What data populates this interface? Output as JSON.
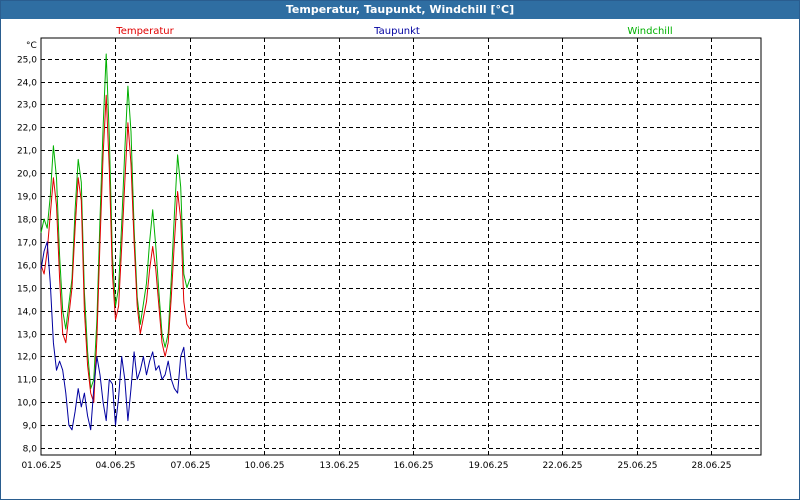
{
  "window": {
    "title": "Temperatur, Taupunkt, Windchill [°C]"
  },
  "colors": {
    "Temperatur": "#e00000",
    "Taupunkt": "#0000a0",
    "Windchill": "#00b000",
    "titlebar": "#2f6ea2"
  },
  "chart_data": {
    "type": "line",
    "title": "Temperatur, Taupunkt, Windchill [°C]",
    "ylabel": "°C",
    "xlabel": "",
    "ylim": [
      7.7,
      25.9
    ],
    "xlim": [
      "01.06.25",
      "30.06.25"
    ],
    "grid": true,
    "legend_position": "top",
    "y_ticks": [
      "8,0",
      "9,0",
      "10,0",
      "11,0",
      "12,0",
      "13,0",
      "14,0",
      "15,0",
      "16,0",
      "17,0",
      "18,0",
      "19,0",
      "20,0",
      "21,0",
      "22,0",
      "23,0",
      "24,0",
      "25,0"
    ],
    "x_ticks": [
      "01.06.25",
      "04.06.25",
      "07.06.25",
      "10.06.25",
      "13.06.25",
      "16.06.25",
      "19.06.25",
      "22.06.25",
      "25.06.25",
      "28.06.25"
    ],
    "series": [
      {
        "name": "Temperatur",
        "points": [
          [
            "01.06.25 00:00",
            16.0
          ],
          [
            "01.06.25 03:00",
            15.6
          ],
          [
            "01.06.25 06:00",
            16.6
          ],
          [
            "01.06.25 09:00",
            18.2
          ],
          [
            "01.06.25 12:00",
            19.8
          ],
          [
            "01.06.25 15:00",
            18.6
          ],
          [
            "01.06.25 18:00",
            15.4
          ],
          [
            "01.06.25 21:00",
            13.0
          ],
          [
            "02.06.25 00:00",
            12.6
          ],
          [
            "02.06.25 06:00",
            15.0
          ],
          [
            "02.06.25 09:00",
            17.6
          ],
          [
            "02.06.25 12:00",
            19.8
          ],
          [
            "02.06.25 15:00",
            18.8
          ],
          [
            "02.06.25 18:00",
            14.0
          ],
          [
            "02.06.25 21:00",
            11.6
          ],
          [
            "03.06.25 00:00",
            10.4
          ],
          [
            "03.06.25 03:00",
            10.0
          ],
          [
            "03.06.25 06:00",
            12.8
          ],
          [
            "03.06.25 09:00",
            17.0
          ],
          [
            "03.06.25 12:00",
            20.8
          ],
          [
            "03.06.25 15:00",
            23.4
          ],
          [
            "03.06.25 18:00",
            20.2
          ],
          [
            "03.06.25 21:00",
            15.6
          ],
          [
            "04.06.25 00:00",
            13.6
          ],
          [
            "04.06.25 03:00",
            14.2
          ],
          [
            "04.06.25 06:00",
            16.8
          ],
          [
            "04.06.25 09:00",
            19.6
          ],
          [
            "04.06.25 12:00",
            22.2
          ],
          [
            "04.06.25 15:00",
            20.4
          ],
          [
            "04.06.25 18:00",
            17.0
          ],
          [
            "04.06.25 21:00",
            14.2
          ],
          [
            "05.06.25 00:00",
            13.0
          ],
          [
            "05.06.25 06:00",
            14.4
          ],
          [
            "05.06.25 09:00",
            15.8
          ],
          [
            "05.06.25 12:00",
            16.8
          ],
          [
            "05.06.25 15:00",
            15.8
          ],
          [
            "05.06.25 18:00",
            14.2
          ],
          [
            "05.06.25 21:00",
            12.6
          ],
          [
            "06.06.25 00:00",
            12.0
          ],
          [
            "06.06.25 03:00",
            12.6
          ],
          [
            "06.06.25 06:00",
            14.6
          ],
          [
            "06.06.25 09:00",
            17.0
          ],
          [
            "06.06.25 12:00",
            19.2
          ],
          [
            "06.06.25 15:00",
            18.0
          ],
          [
            "06.06.25 18:00",
            14.4
          ],
          [
            "06.06.25 21:00",
            13.4
          ],
          [
            "07.06.25 00:00",
            13.2
          ]
        ]
      },
      {
        "name": "Taupunkt",
        "points": [
          [
            "01.06.25 00:00",
            15.8
          ],
          [
            "01.06.25 03:00",
            16.6
          ],
          [
            "01.06.25 06:00",
            17.0
          ],
          [
            "01.06.25 09:00",
            15.2
          ],
          [
            "01.06.25 12:00",
            12.6
          ],
          [
            "01.06.25 15:00",
            11.4
          ],
          [
            "01.06.25 18:00",
            11.8
          ],
          [
            "01.06.25 21:00",
            11.4
          ],
          [
            "02.06.25 00:00",
            10.4
          ],
          [
            "02.06.25 03:00",
            9.0
          ],
          [
            "02.06.25 06:00",
            8.8
          ],
          [
            "02.06.25 09:00",
            9.6
          ],
          [
            "02.06.25 12:00",
            10.6
          ],
          [
            "02.06.25 15:00",
            9.8
          ],
          [
            "02.06.25 18:00",
            10.4
          ],
          [
            "02.06.25 21:00",
            9.4
          ],
          [
            "03.06.25 00:00",
            8.8
          ],
          [
            "03.06.25 03:00",
            10.6
          ],
          [
            "03.06.25 06:00",
            12.0
          ],
          [
            "03.06.25 09:00",
            11.2
          ],
          [
            "03.06.25 12:00",
            10.0
          ],
          [
            "03.06.25 15:00",
            9.2
          ],
          [
            "03.06.25 18:00",
            11.0
          ],
          [
            "03.06.25 21:00",
            10.8
          ],
          [
            "04.06.25 00:00",
            9.0
          ],
          [
            "04.06.25 03:00",
            10.2
          ],
          [
            "04.06.25 06:00",
            12.0
          ],
          [
            "04.06.25 09:00",
            11.0
          ],
          [
            "04.06.25 12:00",
            9.2
          ],
          [
            "04.06.25 15:00",
            10.6
          ],
          [
            "04.06.25 18:00",
            12.2
          ],
          [
            "04.06.25 21:00",
            11.0
          ],
          [
            "05.06.25 00:00",
            11.4
          ],
          [
            "05.06.25 03:00",
            12.0
          ],
          [
            "05.06.25 06:00",
            11.2
          ],
          [
            "05.06.25 09:00",
            11.8
          ],
          [
            "05.06.25 12:00",
            12.2
          ],
          [
            "05.06.25 15:00",
            11.4
          ],
          [
            "05.06.25 18:00",
            11.6
          ],
          [
            "05.06.25 21:00",
            11.0
          ],
          [
            "06.06.25 00:00",
            11.2
          ],
          [
            "06.06.25 03:00",
            11.8
          ],
          [
            "06.06.25 06:00",
            11.0
          ],
          [
            "06.06.25 09:00",
            10.6
          ],
          [
            "06.06.25 12:00",
            10.4
          ],
          [
            "06.06.25 15:00",
            12.0
          ],
          [
            "06.06.25 18:00",
            12.4
          ],
          [
            "06.06.25 21:00",
            11.0
          ],
          [
            "07.06.25 00:00",
            11.0
          ]
        ]
      },
      {
        "name": "Windchill",
        "points": [
          [
            "01.06.25 00:00",
            17.4
          ],
          [
            "01.06.25 03:00",
            18.0
          ],
          [
            "01.06.25 06:00",
            17.6
          ],
          [
            "01.06.25 09:00",
            19.0
          ],
          [
            "01.06.25 12:00",
            21.2
          ],
          [
            "01.06.25 15:00",
            19.8
          ],
          [
            "01.06.25 18:00",
            16.4
          ],
          [
            "01.06.25 21:00",
            14.0
          ],
          [
            "02.06.25 00:00",
            13.2
          ],
          [
            "02.06.25 06:00",
            15.4
          ],
          [
            "02.06.25 09:00",
            18.4
          ],
          [
            "02.06.25 12:00",
            20.6
          ],
          [
            "02.06.25 15:00",
            19.6
          ],
          [
            "02.06.25 18:00",
            14.8
          ],
          [
            "02.06.25 21:00",
            12.2
          ],
          [
            "03.06.25 00:00",
            10.6
          ],
          [
            "03.06.25 03:00",
            11.0
          ],
          [
            "03.06.25 06:00",
            13.6
          ],
          [
            "03.06.25 09:00",
            18.0
          ],
          [
            "03.06.25 12:00",
            22.0
          ],
          [
            "03.06.25 15:00",
            25.2
          ],
          [
            "03.06.25 18:00",
            21.6
          ],
          [
            "03.06.25 21:00",
            16.4
          ],
          [
            "04.06.25 00:00",
            14.2
          ],
          [
            "04.06.25 03:00",
            15.0
          ],
          [
            "04.06.25 06:00",
            17.8
          ],
          [
            "04.06.25 09:00",
            21.0
          ],
          [
            "04.06.25 12:00",
            23.8
          ],
          [
            "04.06.25 15:00",
            21.8
          ],
          [
            "04.06.25 18:00",
            17.6
          ],
          [
            "04.06.25 21:00",
            14.6
          ],
          [
            "05.06.25 00:00",
            13.4
          ],
          [
            "05.06.25 06:00",
            15.2
          ],
          [
            "05.06.25 09:00",
            17.0
          ],
          [
            "05.06.25 12:00",
            18.4
          ],
          [
            "05.06.25 15:00",
            16.8
          ],
          [
            "05.06.25 18:00",
            14.8
          ],
          [
            "05.06.25 21:00",
            13.0
          ],
          [
            "06.06.25 00:00",
            12.4
          ],
          [
            "06.06.25 03:00",
            13.0
          ],
          [
            "06.06.25 06:00",
            15.4
          ],
          [
            "06.06.25 09:00",
            18.2
          ],
          [
            "06.06.25 12:00",
            20.8
          ],
          [
            "06.06.25 15:00",
            19.4
          ],
          [
            "06.06.25 18:00",
            15.6
          ],
          [
            "06.06.25 21:00",
            15.0
          ],
          [
            "07.06.25 00:00",
            15.4
          ]
        ]
      }
    ]
  }
}
